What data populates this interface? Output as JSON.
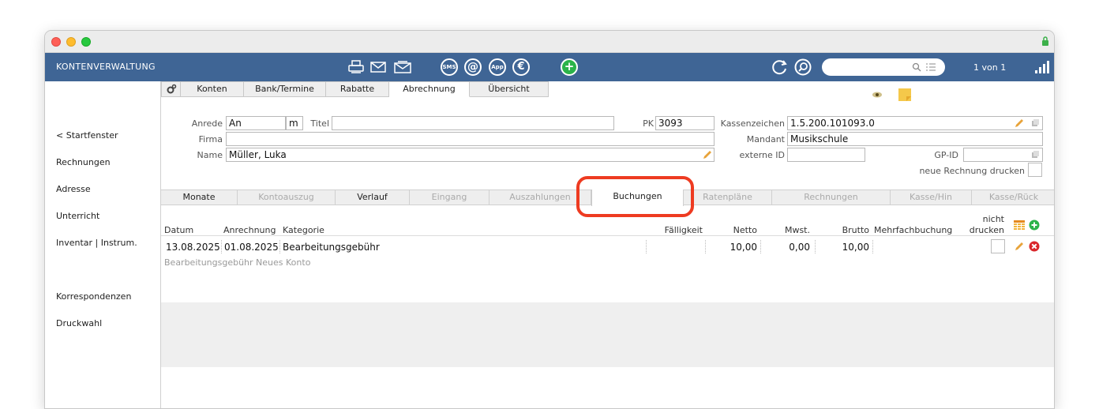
{
  "toolbar": {
    "app_title": "KONTENVERWALTUNG",
    "pager": "1 von 1",
    "icons": [
      "print-icon",
      "mail-icon",
      "letter-icon",
      "sms-icon",
      "at-icon",
      "app-icon",
      "euro-icon",
      "add-icon",
      "refresh-icon",
      "search-icon",
      "stats-icon"
    ],
    "icon_labels": {
      "sms": "SMS",
      "at": "@",
      "app": "App",
      "euro": "€",
      "add": "+"
    },
    "search": {
      "value": "",
      "placeholder": ""
    }
  },
  "sidebar": {
    "items": [
      "< Startfenster",
      "Rechnungen",
      "Adresse",
      "Unterricht",
      "Inventar | Instrum.",
      "Korrespondenzen",
      "Druckwahl"
    ]
  },
  "tabs_top": [
    "Konten",
    "Bank/Termine",
    "Rabatte",
    "Abrechnung",
    "Übersicht"
  ],
  "active_top_tab": "Abrechnung",
  "form": {
    "anrede_label": "Anrede",
    "anrede_value": "An",
    "gender_value": "m",
    "titel_label": "Titel",
    "titel_value": "",
    "firma_label": "Firma",
    "firma_value": "",
    "name_label": "Name",
    "name_value": "Müller, Luka",
    "pk_label": "PK",
    "pk_value": "3093",
    "kassenzeichen_label": "Kassenzeichen",
    "kassenzeichen_value": "1.5.200.101093.0",
    "mandant_label": "Mandant",
    "mandant_value": "Musikschule",
    "externe_id_label": "externe ID",
    "externe_id_value": "",
    "gp_id_label": "GP-ID",
    "gp_id_value": "",
    "neue_rechnung_label": "neue Rechnung drucken"
  },
  "sub_tabs": [
    {
      "label": "Monate",
      "enabled": true
    },
    {
      "label": "Kontoauszug",
      "enabled": false
    },
    {
      "label": "Verlauf",
      "enabled": true
    },
    {
      "label": "Eingang",
      "enabled": false
    },
    {
      "label": "Auszahlungen",
      "enabled": false
    },
    {
      "label": "Buchungen",
      "enabled": true
    },
    {
      "label": "Ratenpläne",
      "enabled": false
    },
    {
      "label": "Rechnungen",
      "enabled": false
    },
    {
      "label": "Kasse/Hin",
      "enabled": false
    },
    {
      "label": "Kasse/Rück",
      "enabled": false
    }
  ],
  "active_sub_tab": "Buchungen",
  "table": {
    "headers": {
      "datum": "Datum",
      "anrechnung": "Anrechnung",
      "kategorie": "Kategorie",
      "faelligkeit": "Fälligkeit",
      "netto": "Netto",
      "mwst": "Mwst.",
      "brutto": "Brutto",
      "mehrfach": "Mehrfachbuchung",
      "nicht": "nicht",
      "drucken": "drucken"
    },
    "rows": [
      {
        "datum": "13.08.2025",
        "anrechnung": "01.08.2025",
        "kategorie": "Bearbeitungsgebühr",
        "faelligkeit": "",
        "netto": "10,00",
        "mwst": "0,00",
        "brutto": "10,00",
        "mehrfach": "",
        "note": "Bearbeitungsgebühr Neues Konto"
      }
    ]
  },
  "colors": {
    "toolbar": "#3f6595",
    "highlight": "#ee3b21",
    "add_green": "#2bb34a",
    "delete_red": "#d9262b",
    "pencil": "#e8a33a"
  }
}
